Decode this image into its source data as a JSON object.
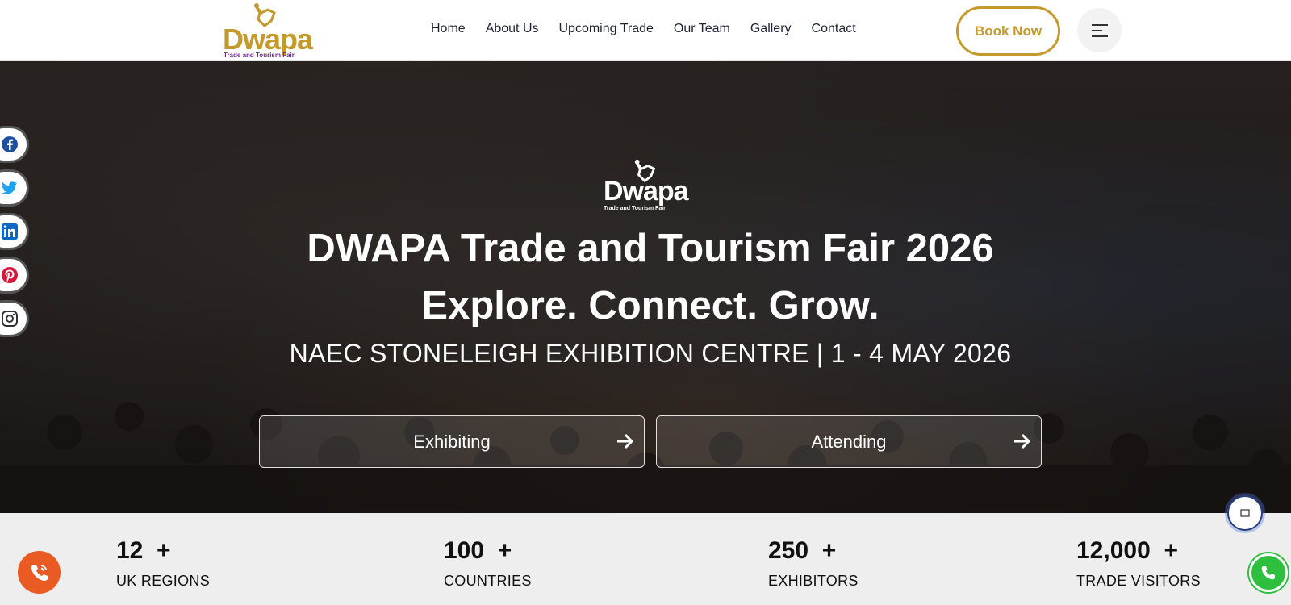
{
  "brand": {
    "wordmark": "Dwapa",
    "tagline": "Trade and Tourism Fair",
    "color_gold": "#c49a2c",
    "color_purple": "#6b2d8a"
  },
  "nav": {
    "items": [
      "Home",
      "About Us",
      "Upcoming Trade",
      "Our Team",
      "Gallery",
      "Contact"
    ],
    "book_label": "Book Now",
    "menu_icon": "menu-lines-icon"
  },
  "hero": {
    "title": "DWAPA Trade and Tourism Fair 2026",
    "subtitle": "Explore. Connect. Grow.",
    "venue": "NAEC STONELEIGH EXHIBITION CENTRE | 1 - 4 MAY 2026",
    "cta_exhibiting": "Exhibiting",
    "cta_attending": "Attending"
  },
  "social": [
    "facebook-icon",
    "twitter-icon",
    "linkedin-icon",
    "pinterest-icon",
    "instagram-icon"
  ],
  "stats": [
    {
      "number": "12",
      "suffix": "+",
      "label": "UK REGIONS"
    },
    {
      "number": "100",
      "suffix": "+",
      "label": "COUNTRIES"
    },
    {
      "number": "250",
      "suffix": "+",
      "label": "EXHIBITORS"
    },
    {
      "number": "12,000",
      "suffix": "+",
      "label": "TRADE VISITORS"
    }
  ],
  "floating": {
    "call_color": "#ea5b24",
    "whatsapp_color": "#2fbf3f"
  }
}
